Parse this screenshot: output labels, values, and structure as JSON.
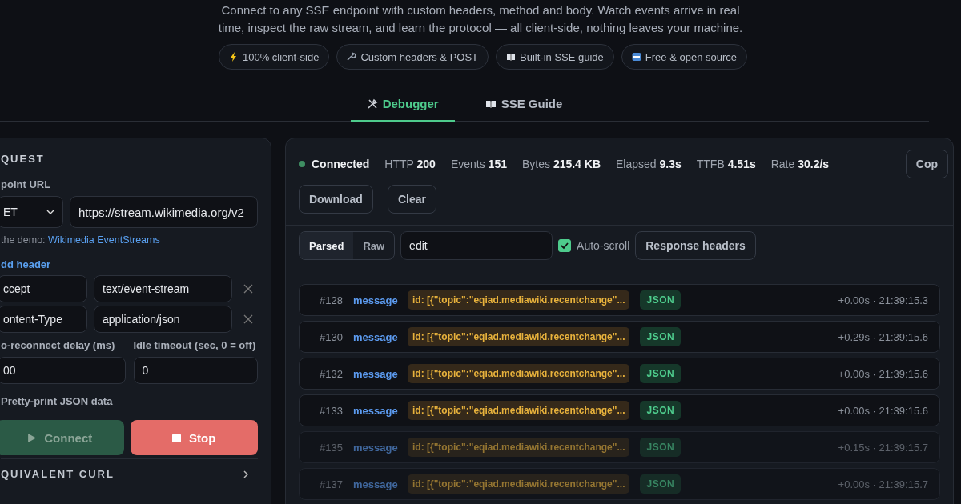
{
  "intro": {
    "lines": [
      "Connect to any SSE endpoint with custom headers, method and body. Watch events arrive in real",
      "time, inspect the raw stream, and learn the protocol — all client-side, nothing leaves your machine."
    ]
  },
  "chips": [
    {
      "kind": "bolt",
      "label": "100% client-side"
    },
    {
      "kind": "wrench",
      "label": "Custom headers & POST"
    },
    {
      "kind": "book",
      "label": "Built-in SSE guide"
    },
    {
      "kind": "free",
      "label": "Free & open source"
    }
  ],
  "tabs": [
    {
      "kind": "tools",
      "label": "Debugger",
      "selected": true
    },
    {
      "kind": "book",
      "label": "SSE Guide",
      "selected": false
    }
  ],
  "request": {
    "title": "QUEST",
    "url_label": "point URL",
    "method": "ET",
    "url": "https://stream.wikimedia.org/v2",
    "demo_prefix": "the demo:",
    "demo_link": "Wikimedia EventStreams",
    "add_header": "dd header",
    "headers": [
      {
        "name": "ccept",
        "value": "text/event-stream"
      },
      {
        "name": "ontent-Type",
        "value": "application/json"
      }
    ],
    "reconnect_label": "o-reconnect delay (ms)",
    "reconnect": "00",
    "idle_label": "Idle timeout (sec, 0 = off)",
    "idle": "0",
    "pretty_label": "Pretty-print JSON data",
    "connect": {
      "label": "Connect",
      "disabled": true
    },
    "stop": "Stop",
    "curl": "QUIVALENT CURL"
  },
  "status": {
    "state": "Connected",
    "connected": true,
    "stats": [
      {
        "label": "HTTP",
        "value": "200"
      },
      {
        "label": "Events",
        "value": "151"
      },
      {
        "label": "Bytes",
        "value": "215.4 KB"
      },
      {
        "label": "Elapsed",
        "value": "9.3s"
      },
      {
        "label": "TTFB",
        "value": "4.51s"
      },
      {
        "label": "Rate",
        "value": "30.2/s"
      }
    ],
    "copy_button": "Cop"
  },
  "actions": [
    "Download",
    "Clear"
  ],
  "views": [
    {
      "label": "Parsed",
      "selected": true
    },
    {
      "label": "Raw",
      "selected": false
    }
  ],
  "filter": "edit",
  "autoscroll": {
    "label": "Auto-scroll",
    "checked": true
  },
  "response_headers": "Response headers",
  "events": [
    {
      "num": "#128",
      "type": "message",
      "id": "id: [{\"topic\":\"eqiad.mediawiki.recentchange\"...",
      "format": "JSON",
      "time": "+0.00s · 21:39:15.3",
      "faded": false
    },
    {
      "num": "#130",
      "type": "message",
      "id": "id: [{\"topic\":\"eqiad.mediawiki.recentchange\"...",
      "format": "JSON",
      "time": "+0.29s · 21:39:15.6",
      "faded": false
    },
    {
      "num": "#132",
      "type": "message",
      "id": "id: [{\"topic\":\"eqiad.mediawiki.recentchange\"...",
      "format": "JSON",
      "time": "+0.00s · 21:39:15.6",
      "faded": false
    },
    {
      "num": "#133",
      "type": "message",
      "id": "id: [{\"topic\":\"eqiad.mediawiki.recentchange\"...",
      "format": "JSON",
      "time": "+0.00s · 21:39:15.6",
      "faded": false
    },
    {
      "num": "#135",
      "type": "message",
      "id": "id: [{\"topic\":\"eqiad.mediawiki.recentchange\"...",
      "format": "JSON",
      "time": "+0.15s · 21:39:15.7",
      "faded": true
    },
    {
      "num": "#137",
      "type": "message",
      "id": "id: [{\"topic\":\"eqiad.mediawiki.recentchange\"...",
      "format": "JSON",
      "time": "+0.00s · 21:39:15.7",
      "faded": true
    }
  ]
}
